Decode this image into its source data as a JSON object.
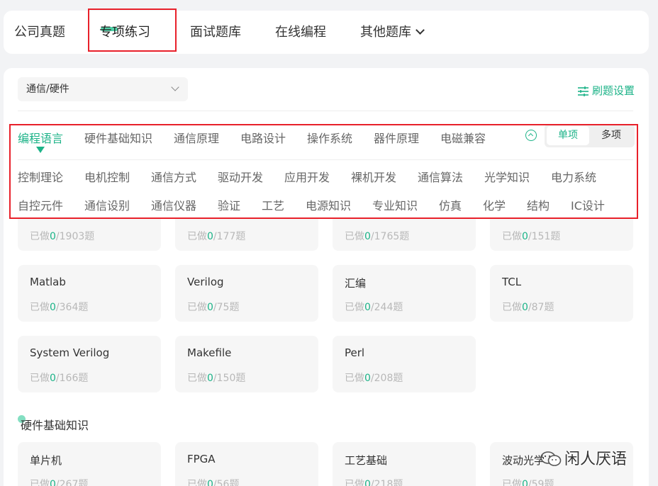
{
  "nav": {
    "tabs": [
      {
        "label": "公司真题"
      },
      {
        "label": "专项练习"
      },
      {
        "label": "面试题库"
      },
      {
        "label": "在线编程"
      },
      {
        "label": "其他题库"
      }
    ],
    "active_tab": "专项练习"
  },
  "filter": {
    "category_select": "通信/硬件",
    "settings_label": "刷题设置"
  },
  "categories": {
    "row1": [
      "编程语言",
      "硬件基础知识",
      "通信原理",
      "电路设计",
      "操作系统",
      "器件原理",
      "电磁兼容"
    ],
    "row2": [
      "控制理论",
      "电机控制",
      "通信方式",
      "驱动开发",
      "应用开发",
      "裸机开发",
      "通信算法",
      "光学知识",
      "电力系统"
    ],
    "row3": [
      "自控元件",
      "通信设别",
      "通信仪器",
      "验证",
      "工艺",
      "电源知识",
      "专业知识",
      "仿真",
      "化学",
      "结构",
      "IC设计"
    ],
    "active": "编程语言"
  },
  "mode_toggle": {
    "single": "单项",
    "multi": "多项",
    "selected": "单项"
  },
  "stat_labels": {
    "prefix": "已做",
    "sep": "/",
    "suffix": "题"
  },
  "cards_partial": [
    {
      "done": "0",
      "total": "1903"
    },
    {
      "done": "0",
      "total": "177"
    },
    {
      "done": "0",
      "total": "1765"
    },
    {
      "done": "0",
      "total": "151"
    }
  ],
  "cards_lang": [
    {
      "name": "Matlab",
      "done": "0",
      "total": "364"
    },
    {
      "name": "Verilog",
      "done": "0",
      "total": "75"
    },
    {
      "name": "汇编",
      "done": "0",
      "total": "244"
    },
    {
      "name": "TCL",
      "done": "0",
      "total": "87"
    },
    {
      "name": "System Verilog",
      "done": "0",
      "total": "166"
    },
    {
      "name": "Makefile",
      "done": "0",
      "total": "150"
    },
    {
      "name": "Perl",
      "done": "0",
      "total": "208"
    }
  ],
  "section_hw": {
    "title": "硬件基础知识",
    "cards": [
      {
        "name": "单片机",
        "done": "0",
        "total": "267"
      },
      {
        "name": "FPGA",
        "done": "0",
        "total": "56"
      },
      {
        "name": "工艺基础",
        "done": "0",
        "total": "218"
      },
      {
        "name": "波动光学",
        "done": "0",
        "total": "59"
      }
    ]
  },
  "watermark": "闲人厌语",
  "colors": {
    "accent": "#1db388",
    "highlight_box": "#e8202a"
  }
}
